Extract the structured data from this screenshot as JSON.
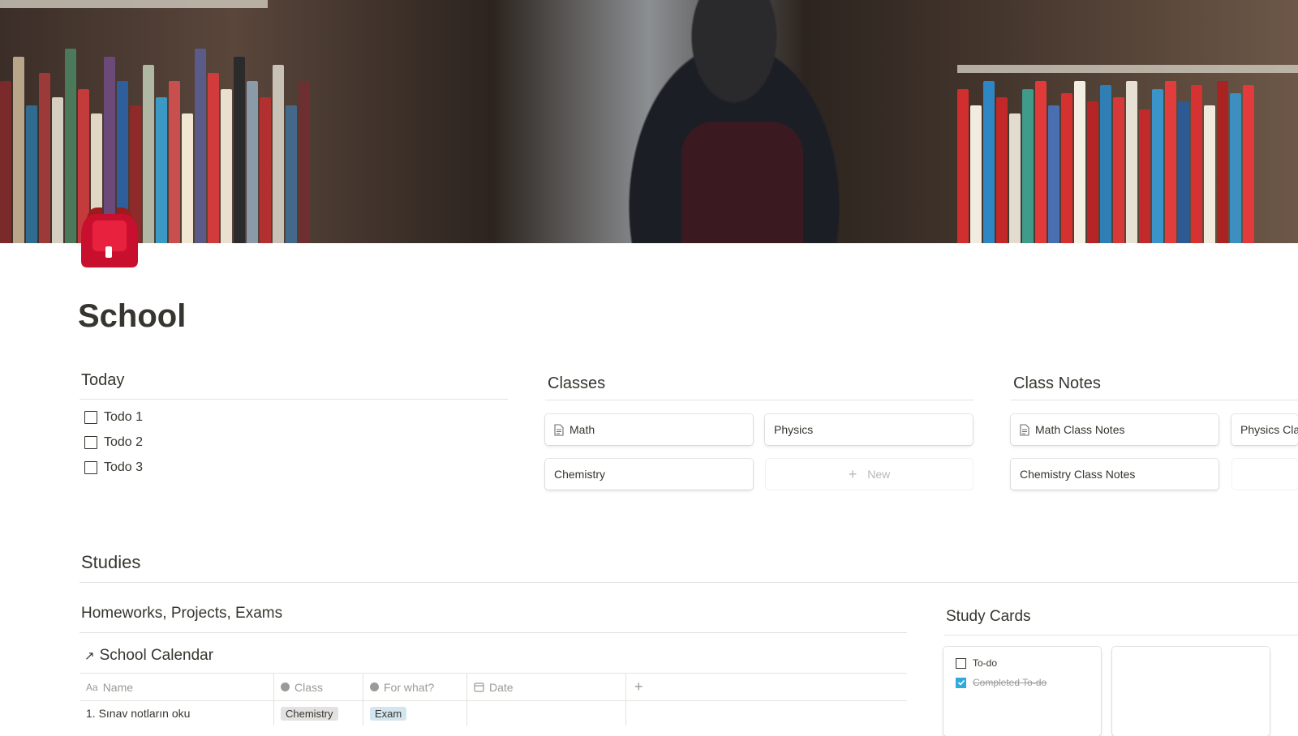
{
  "page": {
    "title": "School",
    "icon": "backpack-icon"
  },
  "today": {
    "heading": "Today",
    "todos": [
      "Todo 1",
      "Todo 2",
      "Todo 3"
    ]
  },
  "classes": {
    "heading": "Classes",
    "items": [
      "Math",
      "Physics",
      "Chemistry"
    ],
    "new_label": "New"
  },
  "class_notes": {
    "heading": "Class Notes",
    "items": [
      "Math Class Notes",
      "Physics Class Notes",
      "Chemistry Class Notes"
    ]
  },
  "studies": {
    "heading": "Studies",
    "hpe": {
      "heading": "Homeworks, Projects, Exams",
      "calendar_link": "School Calendar",
      "columns": [
        "Name",
        "Class",
        "For what?",
        "Date"
      ],
      "rows": [
        {
          "name": "1. Sınav notların oku",
          "class": "Chemistry",
          "for_what": "Exam",
          "date": ""
        }
      ]
    },
    "study_cards": {
      "heading": "Study Cards",
      "todo_label": "To-do",
      "completed_label": "Completed To-do"
    }
  },
  "colors": {
    "text": "#37352f",
    "muted": "#9b9a97",
    "divider": "#e3e2df",
    "tag_chemistry": "#e3e2e0",
    "tag_exam": "#d3e5ef",
    "checkbox_checked": "#2eaadc",
    "backpack_red": "#c8102e"
  }
}
